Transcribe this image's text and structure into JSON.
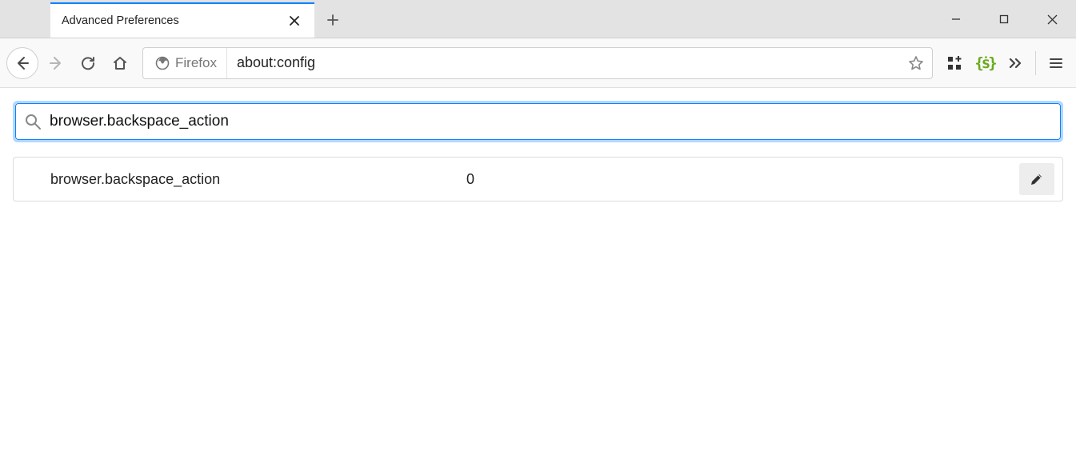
{
  "tab": {
    "title": "Advanced Preferences"
  },
  "urlbar": {
    "identity_label": "Firefox",
    "url": "about:config"
  },
  "search": {
    "value": "browser.backspace_action"
  },
  "results": [
    {
      "name": "browser.backspace_action",
      "value": "0"
    }
  ]
}
